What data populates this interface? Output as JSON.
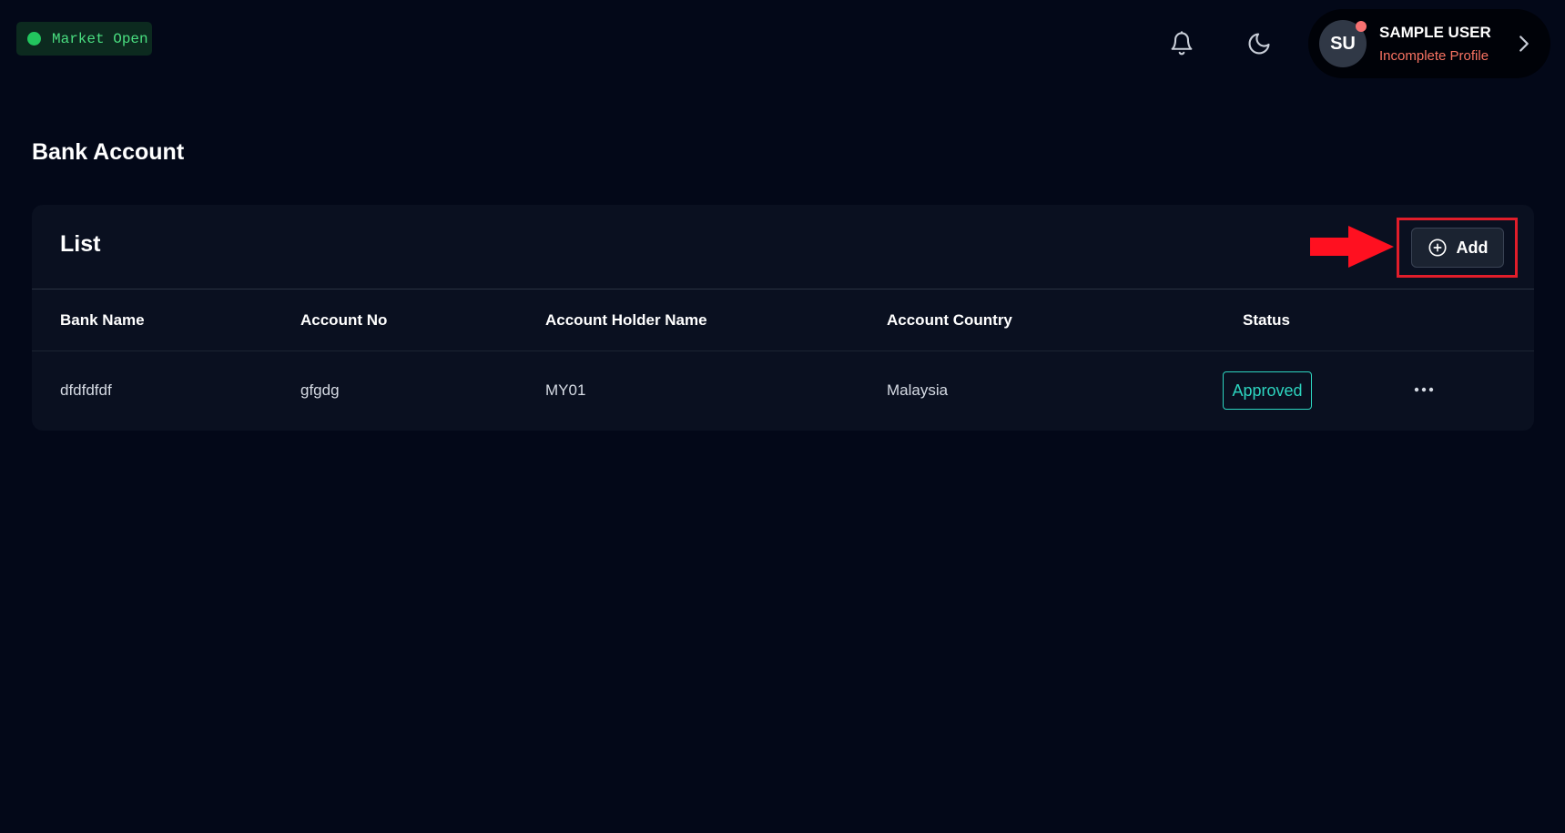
{
  "topbar": {
    "market_status": "Market Open",
    "user": {
      "initials": "SU",
      "name": "SAMPLE USER",
      "profile_status": "Incomplete Profile"
    },
    "icons": {
      "notifications": "bell-icon",
      "theme": "moon-icon",
      "expand": "chevron-right-icon"
    }
  },
  "page": {
    "title": "Bank Account"
  },
  "card": {
    "title": "List",
    "add_label": "Add",
    "columns": [
      "Bank Name",
      "Account No",
      "Account Holder Name",
      "Account Country",
      "Status"
    ],
    "rows": [
      {
        "bank_name": "dfdfdfdf",
        "account_no": "gfgdg",
        "holder_name": "MY01",
        "country": "Malaysia",
        "status": "Approved"
      }
    ]
  },
  "colors": {
    "background": "#030818",
    "card": "#0a1020",
    "market_green": "#22c55e",
    "approved": "#2dd4bf",
    "alert": "#f97362",
    "highlight_red": "#e11d2a"
  }
}
